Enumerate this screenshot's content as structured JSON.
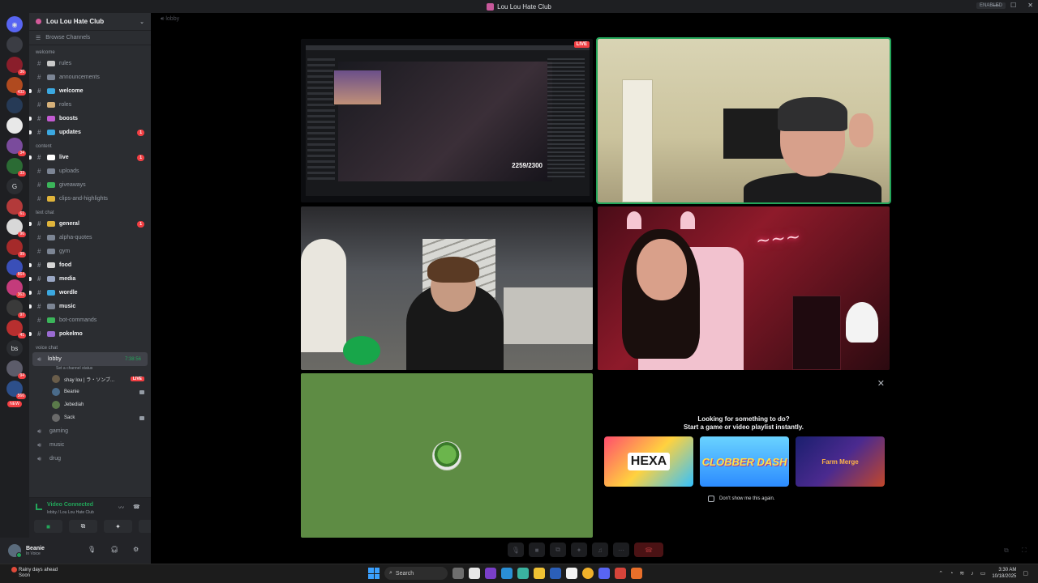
{
  "window": {
    "title": "Lou Lou Hate Club",
    "enabled_badge": "ENABLED"
  },
  "server": {
    "name": "Lou Lou Hate Club",
    "browse": "Browse Channels"
  },
  "rail": {
    "items": [
      {
        "name": "server-1",
        "color": "#3b3d44",
        "badge": ""
      },
      {
        "name": "server-2",
        "color": "#8a1e2b",
        "badge": "36"
      },
      {
        "name": "server-3",
        "color": "#b04a1f",
        "badge": "432"
      },
      {
        "name": "server-4",
        "color": "#263a56",
        "badge": ""
      },
      {
        "name": "server-5",
        "color": "#e8e8e8",
        "badge": ""
      },
      {
        "name": "server-6",
        "color": "#7a4b9c",
        "badge": "34"
      },
      {
        "name": "server-7",
        "color": "#2b6b34",
        "badge": "33"
      },
      {
        "name": "server-8",
        "color": "#b33a3a",
        "badge": "61"
      },
      {
        "name": "server-9",
        "color": "#d8d8d8",
        "badge": "96"
      },
      {
        "name": "server-10",
        "color": "#a52a2a",
        "badge": "99"
      },
      {
        "name": "server-11",
        "color": "#3a4fb8",
        "badge": "864"
      },
      {
        "name": "server-12",
        "color": "#c43b7b",
        "badge": "363"
      },
      {
        "name": "server-13",
        "color": "#3a3a3a",
        "badge": "97"
      },
      {
        "name": "server-14",
        "color": "#b82f2f",
        "badge": "41"
      },
      {
        "name": "server-15",
        "color": "#5c5c6a",
        "badge": "94"
      },
      {
        "name": "server-16",
        "color": "#2d4f8a",
        "badge": "566"
      }
    ],
    "text_g": "G",
    "text_bs": "bs",
    "new_badge": "NEW"
  },
  "categories": {
    "welcome": "welcome",
    "content": "content",
    "text_chat": "text chat",
    "voice_chat": "voice chat"
  },
  "welcome_channels": [
    {
      "label": "rules",
      "unread": false,
      "color": "#c9c9c9",
      "count": ""
    },
    {
      "label": "announcements",
      "unread": false,
      "color": "#7c8594",
      "count": ""
    },
    {
      "label": "welcome",
      "unread": true,
      "color": "#3ba8e0",
      "count": ""
    },
    {
      "label": "roles",
      "unread": false,
      "color": "#d6b17a",
      "count": ""
    },
    {
      "label": "boosts",
      "unread": true,
      "color": "#c35bd2",
      "count": ""
    },
    {
      "label": "updates",
      "unread": true,
      "color": "#3ba8e0",
      "count": "1"
    }
  ],
  "content_channels": [
    {
      "label": "live",
      "unread": true,
      "color": "#ffffff",
      "count": "1"
    },
    {
      "label": "uploads",
      "unread": false,
      "color": "#7c8594",
      "count": ""
    },
    {
      "label": "giveaways",
      "unread": false,
      "color": "#3bb55a",
      "count": ""
    },
    {
      "label": "clips-and-highlights",
      "unread": false,
      "color": "#e0b43b",
      "count": ""
    }
  ],
  "text_channels": [
    {
      "label": "general",
      "unread": true,
      "color": "#e0b43b",
      "count": "1"
    },
    {
      "label": "alpha-quotes",
      "unread": false,
      "color": "#7c8594",
      "count": ""
    },
    {
      "label": "gym",
      "unread": false,
      "color": "#7c8594",
      "count": ""
    },
    {
      "label": "food",
      "unread": true,
      "color": "#d6d6d6",
      "count": ""
    },
    {
      "label": "media",
      "unread": true,
      "color": "#9aa7c4",
      "count": ""
    },
    {
      "label": "wordle",
      "unread": true,
      "color": "#3ba8e0",
      "count": ""
    },
    {
      "label": "music",
      "unread": true,
      "color": "#7c8594",
      "count": ""
    },
    {
      "label": "bot-commands",
      "unread": false,
      "color": "#3bb55a",
      "count": ""
    },
    {
      "label": "pokelmo",
      "unread": true,
      "color": "#9a6bd2",
      "count": ""
    }
  ],
  "voice": {
    "lobby": {
      "label": "lobby",
      "time": "7:38:56",
      "status": "Set a channel status"
    },
    "users": [
      {
        "name": "shay lou | ラ・ソンブ...",
        "avatar": "#6a5d4a",
        "live": "LIVE",
        "cam": false
      },
      {
        "name": "Beanie",
        "avatar": "#4a6b8a",
        "live": "",
        "cam": true
      },
      {
        "name": "Jebediah",
        "avatar": "#5a7a4a",
        "live": "",
        "cam": false
      },
      {
        "name": "Sack",
        "avatar": "#6a6a6a",
        "live": "",
        "cam": true
      }
    ],
    "other_channels": [
      "gaming",
      "music",
      "drug"
    ]
  },
  "voice_connected": {
    "title": "Video Connected",
    "subtitle": "lobby / Lou Lou Hate Club"
  },
  "user": {
    "name": "Beanie",
    "status": "In Voice"
  },
  "main": {
    "header": "lobby",
    "live_tag": "LIVE",
    "share_count": "2259/2300"
  },
  "activity": {
    "line1": "Looking for something to do?",
    "line2": "Start a game or video playlist instantly.",
    "games": [
      "HEXA",
      "CLOBBER DASH",
      "Farm Merge"
    ],
    "checkbox": "Don't show me this again."
  },
  "taskbar": {
    "weather": "Rainy days ahead",
    "weather_sub": "Soon",
    "search": "Search",
    "time": "3:30 AM",
    "date": "10/18/2025"
  }
}
